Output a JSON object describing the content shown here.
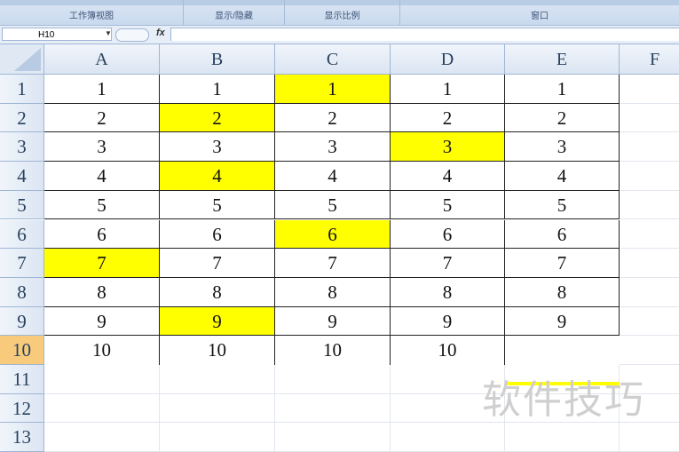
{
  "ribbon": {
    "groups": [
      {
        "label": "工作簿视图"
      },
      {
        "label": "显示/隐藏"
      },
      {
        "label": "显示比例"
      },
      {
        "label": "窗口"
      }
    ]
  },
  "formula_bar": {
    "name_box": "H10",
    "fx_label": "fx",
    "value": ""
  },
  "sheet": {
    "columns": [
      "A",
      "B",
      "C",
      "D",
      "E",
      "F"
    ],
    "rows": [
      "1",
      "2",
      "3",
      "4",
      "5",
      "6",
      "7",
      "8",
      "9",
      "10",
      "11",
      "12",
      "13"
    ],
    "selected_row": "10",
    "cells": [
      [
        "1",
        "1",
        "1",
        "1",
        "1"
      ],
      [
        "2",
        "2",
        "2",
        "2",
        "2"
      ],
      [
        "3",
        "3",
        "3",
        "3",
        "3"
      ],
      [
        "4",
        "4",
        "4",
        "4",
        "4"
      ],
      [
        "5",
        "5",
        "5",
        "5",
        "5"
      ],
      [
        "6",
        "6",
        "6",
        "6",
        "6"
      ],
      [
        "7",
        "7",
        "7",
        "7",
        "7"
      ],
      [
        "8",
        "8",
        "8",
        "8",
        "8"
      ],
      [
        "9",
        "9",
        "9",
        "9",
        "9"
      ],
      [
        "10",
        "10",
        "10",
        "10",
        ""
      ]
    ],
    "highlights": [
      "C1",
      "B2",
      "D3",
      "B4",
      "C6",
      "A7",
      "B9",
      "E10"
    ],
    "highlight_color": "#ffff00",
    "selected_row_color": "#f8cb7c"
  },
  "watermark": "软件技巧"
}
